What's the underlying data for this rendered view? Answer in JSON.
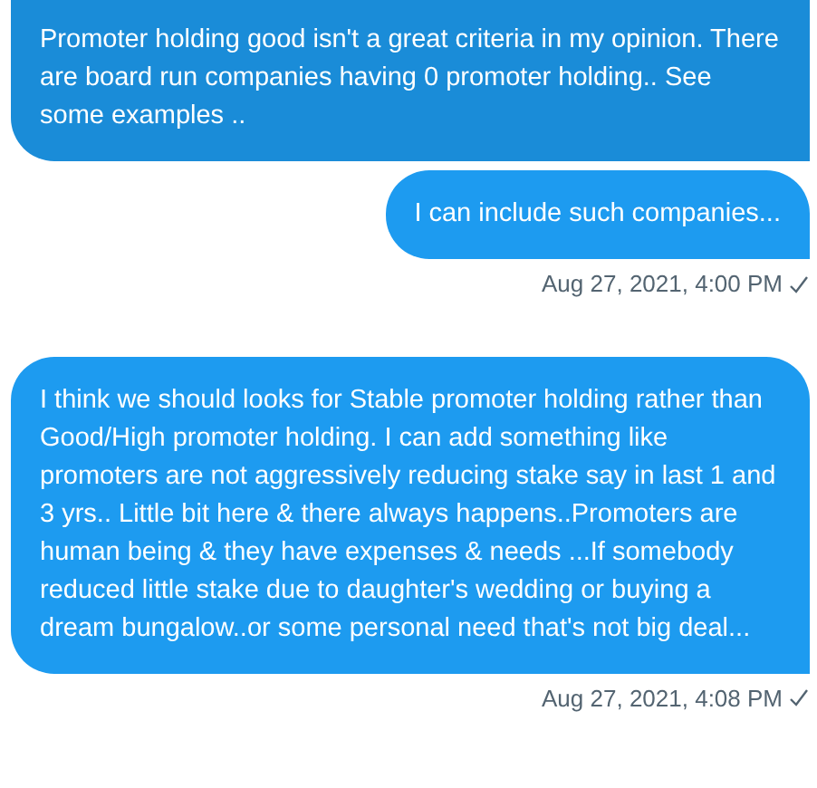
{
  "messages": [
    {
      "text": "Promoter holding good isn't a great criteria in my opinion. There are board run companies having 0 promoter holding.. See some examples ..",
      "hovered": true
    },
    {
      "text": "I can include such companies...",
      "hovered": false,
      "timestamp": "Aug 27, 2021, 4:00 PM",
      "seen": true
    },
    {
      "text": "I think we should looks for Stable promoter holding rather than Good/High promoter holding. I can add something like promoters are not aggressively reducing stake say in last 1 and 3 yrs.. Little bit here & there always happens..Promoters are human being & they have expenses & needs ...If somebody reduced little stake due to daughter's wedding or buying a dream bungalow..or some personal need that's not big deal...",
      "hovered": false,
      "timestamp": "Aug 27, 2021, 4:08 PM",
      "seen": true
    }
  ]
}
